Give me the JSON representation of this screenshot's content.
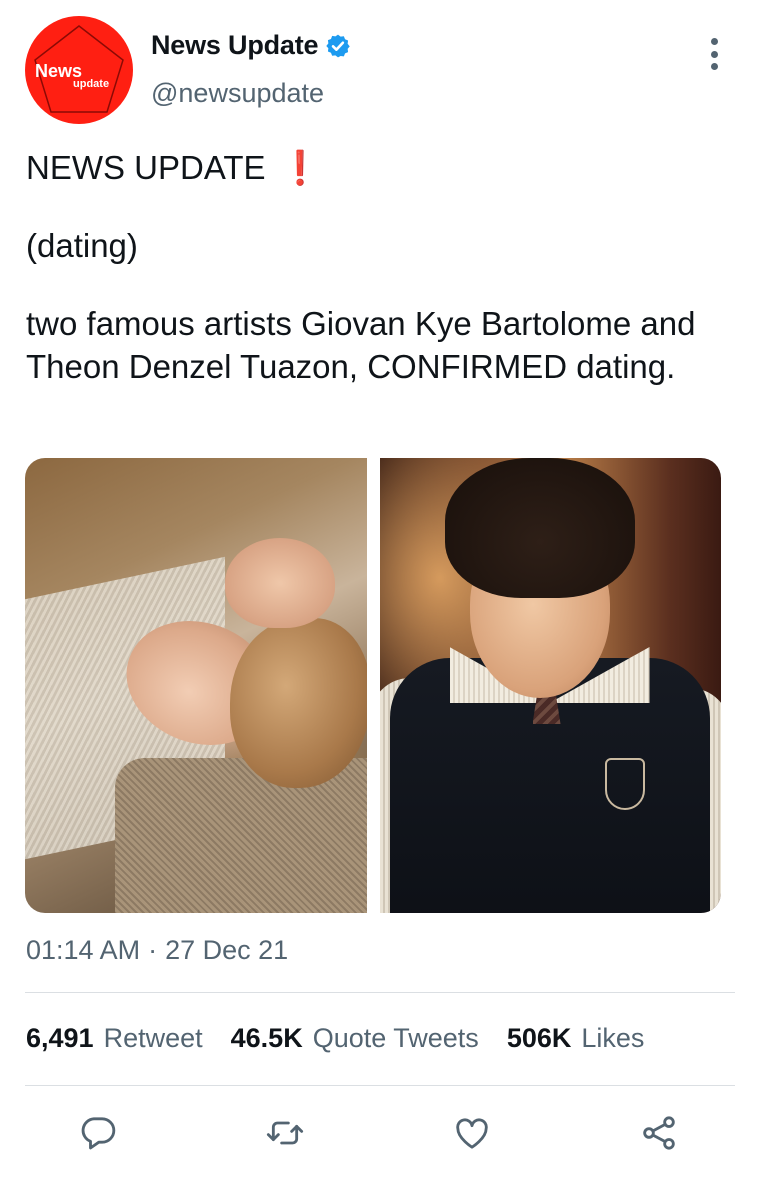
{
  "author": {
    "display_name": "News Update",
    "handle": "@newsupdate",
    "verified": true,
    "avatar_logo_main": "News",
    "avatar_logo_sub": "update",
    "avatar_color": "#ff1f12"
  },
  "tweet": {
    "line1": "NEWS UPDATE",
    "line1_emoji": "❗",
    "line2": "(dating)",
    "line3": "two famous artists Giovan Kye Bartolome and Theon Denzel Tuazon, CONFIRMED dating.",
    "media_count": 2
  },
  "meta": {
    "time": "01:14 AM",
    "separator": "·",
    "date": "27 Dec 21"
  },
  "stats": {
    "retweets_value": "6,491",
    "retweets_label": "Retweet",
    "quotes_value": "46.5K",
    "quotes_label": "Quote Tweets",
    "likes_value": "506K",
    "likes_label": "Likes"
  },
  "actions": [
    "reply-icon",
    "retweet-icon",
    "like-icon",
    "share-icon"
  ],
  "colors": {
    "text_primary": "#0f1419",
    "text_secondary": "#536471",
    "verified_blue": "#1d9bf0",
    "emoji_red": "#e0202b"
  }
}
